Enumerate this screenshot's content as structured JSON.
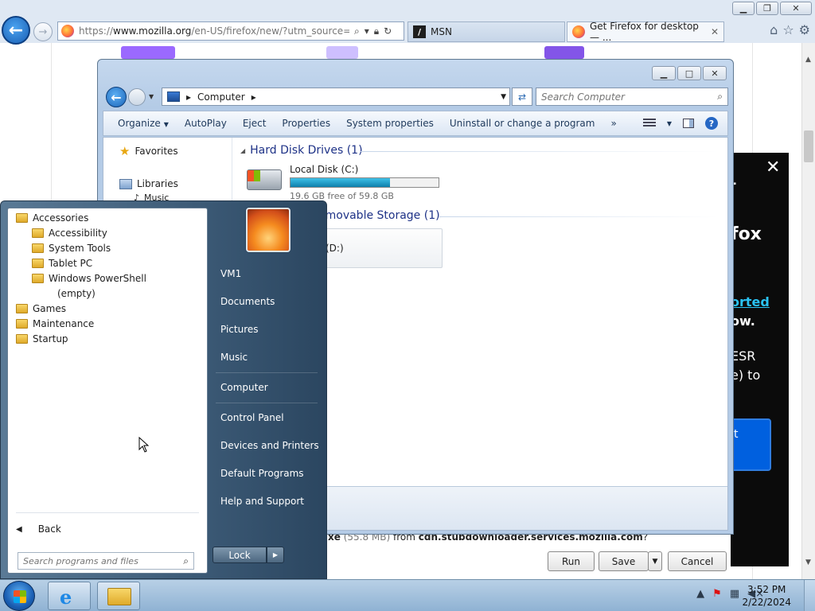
{
  "browser": {
    "url_main": "https://www.mozilla.org/en-US/firefox/new/?utm_source=yout",
    "url_host_prefix": "https://",
    "url_host": "www.mozilla.org",
    "url_path": "/en-US/firefox/new/?utm_source=youtu",
    "tabs": [
      {
        "label": "MSN",
        "active": false
      },
      {
        "label": "Get Firefox for desktop — ...",
        "active": true
      }
    ]
  },
  "promo": {
    "close": "✕",
    "line1": "-",
    "line2": "fox",
    "line3": "orted",
    "line4": "ow.",
    "line5": "ESR",
    "line6": "e) to",
    "cta": "t"
  },
  "download": {
    "filename": "xe",
    "size": "(55.8 MB)",
    "from_word": "from",
    "host": "cdn.stubdownloader.services.mozilla.com",
    "suffix": "?",
    "run": "Run",
    "save": "Save",
    "cancel": "Cancel"
  },
  "explorer": {
    "address": "Computer",
    "search_placeholder": "Search Computer",
    "commands": [
      "Organize",
      "AutoPlay",
      "Eject",
      "Properties",
      "System properties",
      "Uninstall or change a program"
    ],
    "more": "»",
    "nav": {
      "favorites": "Favorites",
      "libraries": "Libraries",
      "music": "Music"
    },
    "groups": {
      "hdd": "Hard Disk Drives (1)",
      "removable": "emovable Storage (1)"
    },
    "drive_c": {
      "name": "Local Disk (C:)",
      "free": "19.6 GB free of 59.8 GB",
      "used_fraction": 0.672
    },
    "drive_d": {
      "label": "(D:)"
    }
  },
  "startmenu": {
    "programs": [
      {
        "label": "Accessories",
        "level": 0,
        "folder": true
      },
      {
        "label": "Accessibility",
        "level": 1,
        "folder": true
      },
      {
        "label": "System Tools",
        "level": 1,
        "folder": true
      },
      {
        "label": "Tablet PC",
        "level": 1,
        "folder": true
      },
      {
        "label": "Windows PowerShell",
        "level": 1,
        "folder": true
      },
      {
        "label": "(empty)",
        "level": 2,
        "folder": false
      },
      {
        "label": "Games",
        "level": 0,
        "folder": true
      },
      {
        "label": "Maintenance",
        "level": 0,
        "folder": true
      },
      {
        "label": "Startup",
        "level": 0,
        "folder": true
      }
    ],
    "back": "Back",
    "search_placeholder": "Search programs and files",
    "right_items": [
      "VM1",
      "Documents",
      "Pictures",
      "Music",
      "Computer",
      "Control Panel",
      "Devices and Printers",
      "Default Programs",
      "Help and Support"
    ],
    "lock": "Lock"
  },
  "taskbar": {
    "time": "3:52 PM",
    "date": "2/22/2024"
  }
}
